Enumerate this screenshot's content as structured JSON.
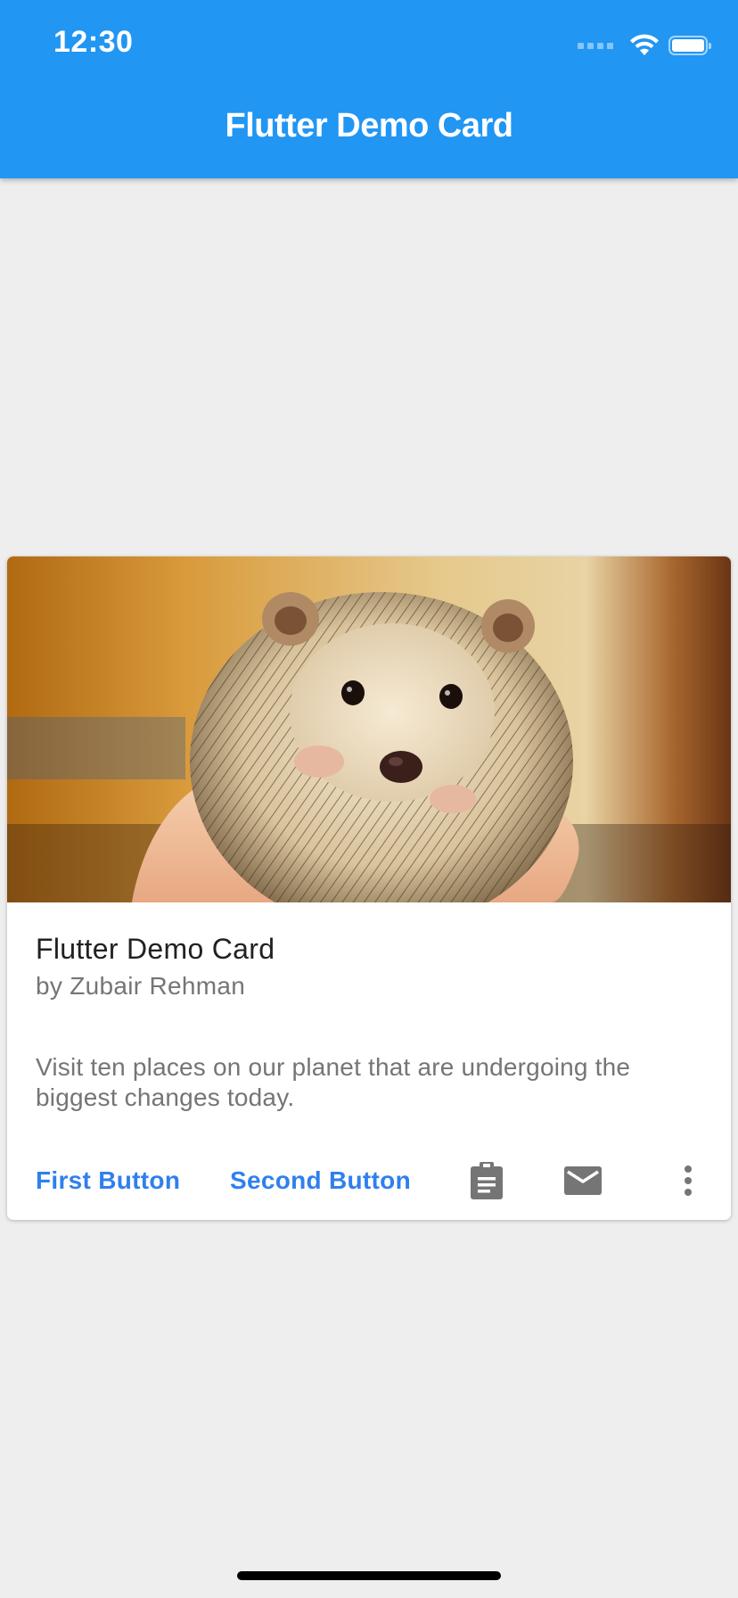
{
  "status_bar": {
    "time": "12:30",
    "battery_level": 1.0
  },
  "app_bar": {
    "title": "Flutter Demo Card",
    "background_color": "#2196f3"
  },
  "card": {
    "image_description_icon": "hedgehog-photo",
    "title": "Flutter Demo Card",
    "subtitle": "by Zubair Rehman",
    "body": "Visit ten places on our planet that are undergoing the biggest changes today.",
    "actions": {
      "first_button": "First Button",
      "second_button": "Second Button",
      "icons": [
        "clipboard-icon",
        "mail-icon",
        "more-vert-icon"
      ]
    },
    "accent_color": "#2f80ed"
  }
}
